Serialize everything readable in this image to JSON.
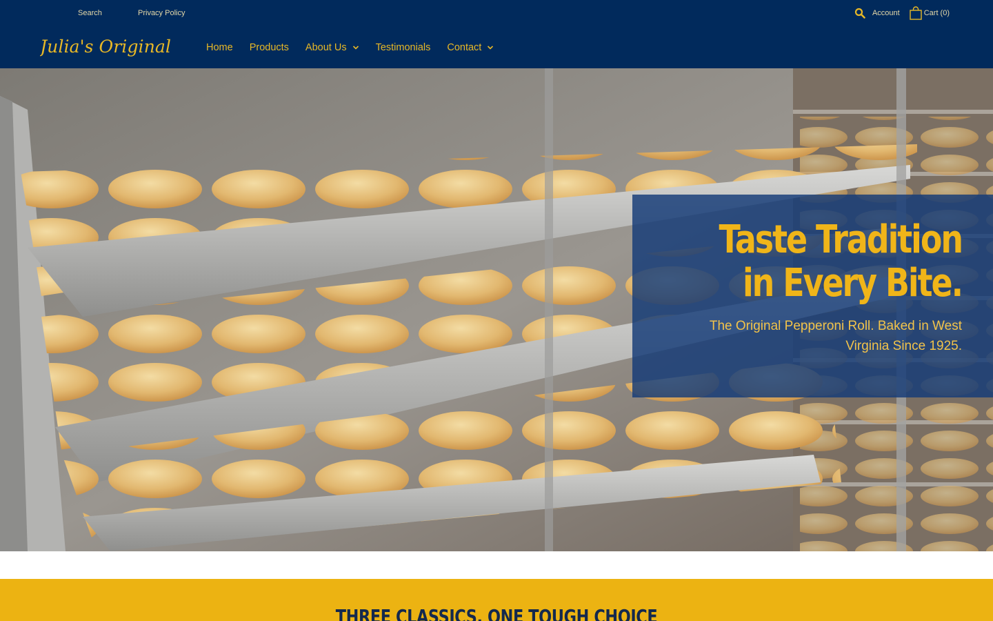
{
  "utility": {
    "search_label": "Search",
    "privacy_label": "Privacy Policy",
    "account_label": "Account",
    "cart_label": "Cart (0)"
  },
  "brand": {
    "logo_text": "Julia's Original"
  },
  "nav": {
    "items": [
      {
        "label": "Home",
        "has_dropdown": false
      },
      {
        "label": "Products",
        "has_dropdown": false
      },
      {
        "label": "About Us",
        "has_dropdown": true
      },
      {
        "label": "Testimonials",
        "has_dropdown": false
      },
      {
        "label": "Contact",
        "has_dropdown": true
      }
    ]
  },
  "hero": {
    "title": "Taste Tradition in Every Bite.",
    "subtitle": "The Original Pepperoni Roll. Baked in West Virginia Since 1925."
  },
  "section": {
    "title": "THREE CLASSICS. ONE TOUGH CHOICE"
  },
  "colors": {
    "header_bg": "#012a5c",
    "accent_gold": "#e8b826",
    "band_yellow": "#ecb312",
    "band_text": "#14294d"
  },
  "icons": [
    "search-icon",
    "shopping-bag-icon",
    "chevron-down-icon"
  ]
}
